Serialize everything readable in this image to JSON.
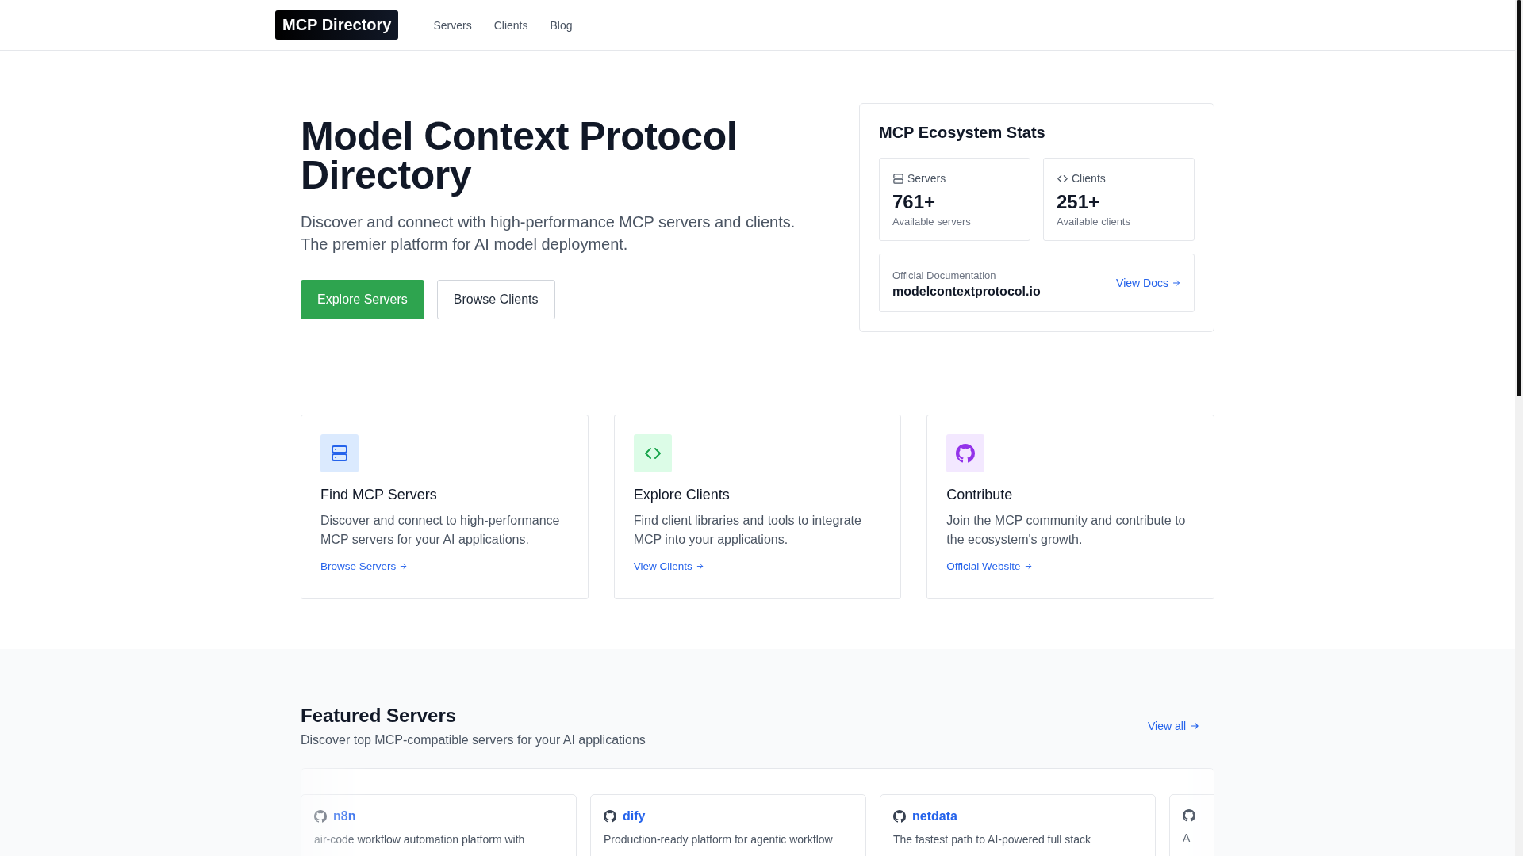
{
  "header": {
    "logo": "MCP Directory",
    "nav": [
      {
        "label": "Servers"
      },
      {
        "label": "Clients"
      },
      {
        "label": "Blog"
      }
    ]
  },
  "hero": {
    "title": "Model Context Protocol Directory",
    "subtitle": "Discover and connect with high-performance MCP servers and clients. The premier platform for AI model deployment.",
    "buttons": [
      {
        "label": "Explore Servers",
        "kind": "primary"
      },
      {
        "label": "Browse Clients",
        "kind": "secondary"
      }
    ]
  },
  "stats": {
    "title": "MCP Ecosystem Stats",
    "items": [
      {
        "kind": "servers",
        "label": "Servers",
        "value": "761+",
        "caption": "Available servers"
      },
      {
        "kind": "clients",
        "label": "Clients",
        "value": "251+",
        "caption": "Available clients"
      }
    ],
    "docs": {
      "label": "Official Documentation",
      "site": "modelcontextprotocol.io",
      "link": "View Docs"
    }
  },
  "features": [
    {
      "kind": "servers",
      "title": "Find MCP Servers",
      "text": "Discover and connect to high-performance MCP servers for your AI applications.",
      "link": "Browse Servers"
    },
    {
      "kind": "clients",
      "title": "Explore Clients",
      "text": "Find client libraries and tools to integrate MCP into your applications.",
      "link": "View Clients"
    },
    {
      "kind": "github",
      "title": "Contribute",
      "text": "Join the MCP community and contribute to the ecosystem's growth.",
      "link": "Official Website"
    }
  ],
  "featured": {
    "title": "Featured Servers",
    "subtitle": "Discover top MCP-compatible servers for your AI applications",
    "view_all": "View all",
    "servers": [
      {
        "name": "n8n",
        "text": "air-code workflow automation platform with"
      },
      {
        "name": "dify",
        "text": "Production-ready platform for agentic workflow"
      },
      {
        "name": "netdata",
        "text": "The fastest path to AI-powered full stack"
      },
      {
        "text": "A"
      }
    ]
  }
}
